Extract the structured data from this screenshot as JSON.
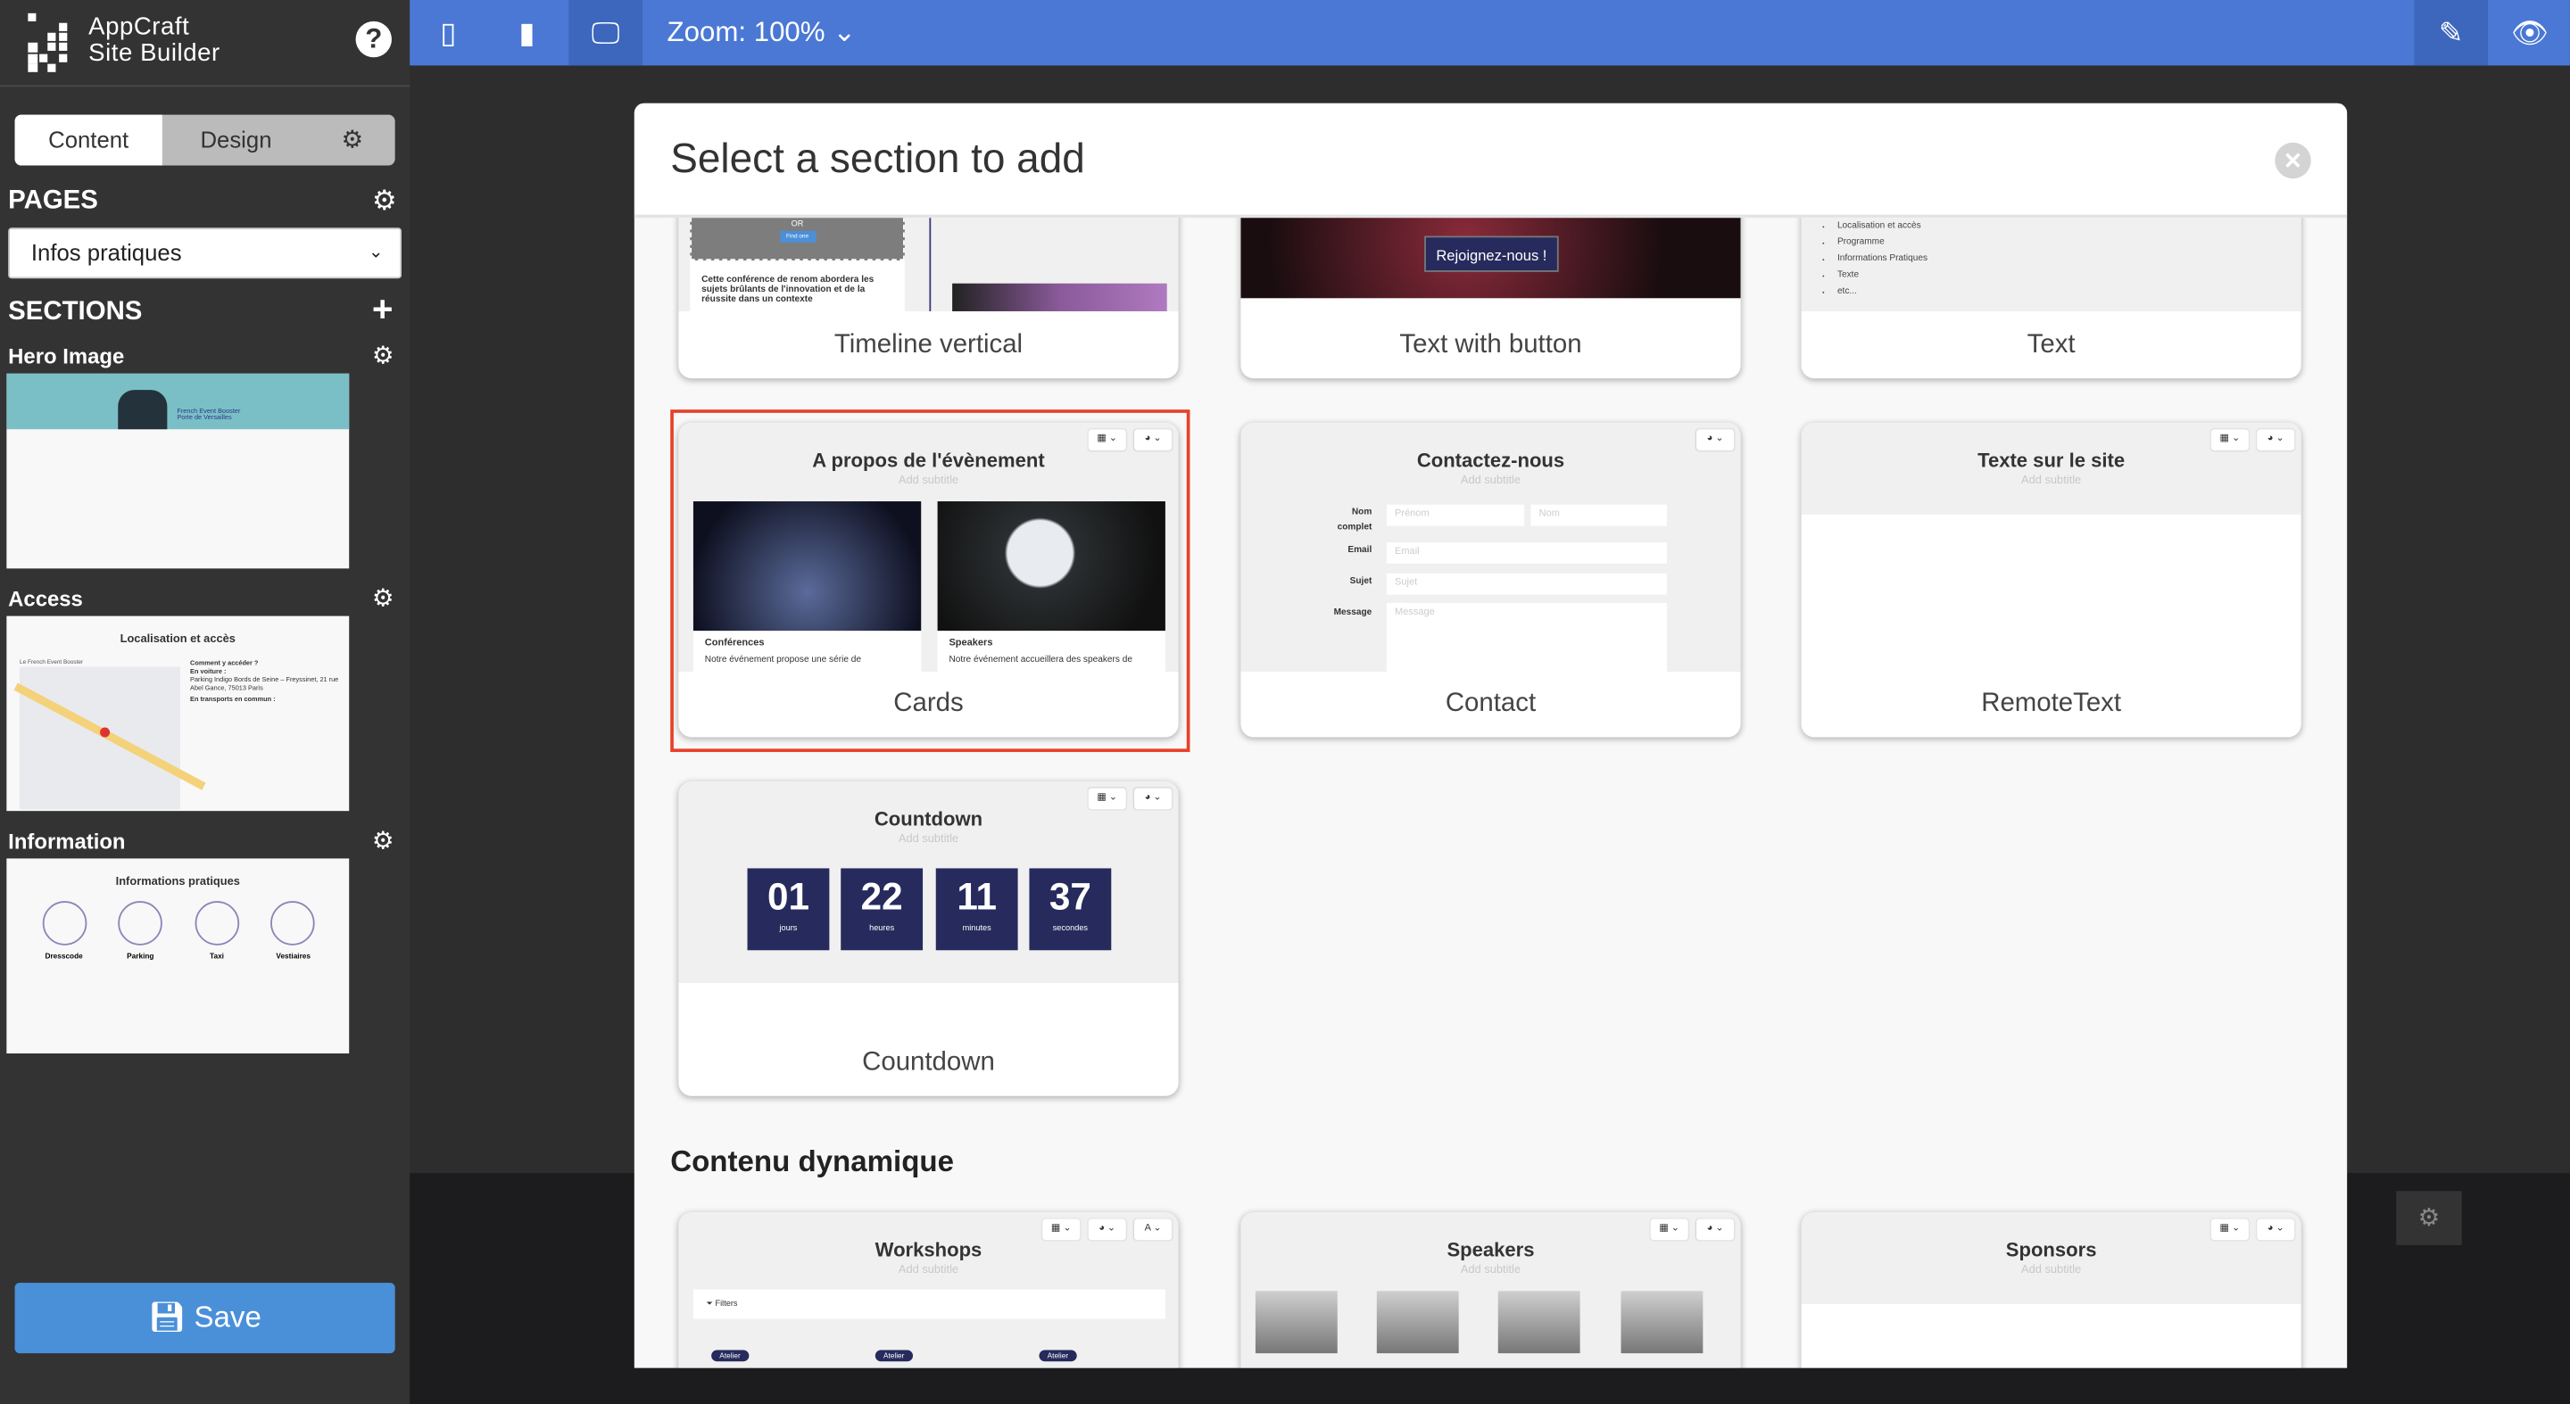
{
  "app": {
    "name_line1": "AppCraft",
    "name_line2": "Site Builder",
    "help_icon": "question-circle-icon"
  },
  "sidebar": {
    "tabs": {
      "content": "Content",
      "design": "Design"
    },
    "pages_heading": "PAGES",
    "page_select": "Infos pratiques",
    "sections_heading": "SECTIONS",
    "sections": [
      {
        "label": "Hero Image",
        "thumb": {
          "caption1": "French Event Booster",
          "caption2": "Porte de Versailles"
        }
      },
      {
        "label": "Access",
        "thumb": {
          "title": "Localisation et accès",
          "map_title": "Le French Event Booster",
          "how": "Comment y accéder ?",
          "car": "En voiture :",
          "addr": "Parking Indigo Bords de Seine – Freyssinet, 21 rue Abel Gance, 75013 Paris",
          "transit": "En transports en commun :"
        }
      },
      {
        "label": "Information",
        "thumb": {
          "title": "Informations pratiques",
          "items": [
            "Dresscode",
            "Parking",
            "Taxi",
            "Vestiaires"
          ]
        }
      }
    ],
    "save": "Save"
  },
  "topbar": {
    "zoom": "Zoom: 100%"
  },
  "modal": {
    "title": "Select a section to add",
    "row1": [
      {
        "label": "Timeline vertical",
        "or": "OR",
        "find": "Find one",
        "text": "Cette conférence de renom abordera les sujets brûlants de l'innovation et de la réussite dans un contexte"
      },
      {
        "label": "Text with button",
        "button": "Rejoignez-nous !"
      },
      {
        "label": "Text",
        "bullets": [
          "Localisation et accès",
          "Programme",
          "Informations Pratiques",
          "Texte",
          "etc..."
        ]
      }
    ],
    "cards": {
      "label": "Cards",
      "title": "A propos de l'évènement",
      "subtitle": "Add subtitle",
      "items": [
        {
          "title": "Conférences",
          "text": "Notre événement propose une série de"
        },
        {
          "title": "Speakers",
          "text": "Notre événement accueillera des speakers de"
        }
      ]
    },
    "contact": {
      "label": "Contact",
      "title": "Contactez-nous",
      "subtitle": "Add subtitle",
      "nom_label": "Nom complet",
      "prenom": "Prénom",
      "nom": "Nom",
      "email_label": "Email",
      "email": "Email",
      "sujet_label": "Sujet",
      "sujet": "Sujet",
      "message_label": "Message",
      "message": "Message"
    },
    "remote": {
      "label": "RemoteText",
      "title": "Texte sur le site",
      "subtitle": "Add subtitle"
    },
    "countdown": {
      "label": "Countdown",
      "title": "Countdown",
      "subtitle": "Add subtitle",
      "units": [
        {
          "v": "01",
          "u": "jours"
        },
        {
          "v": "22",
          "u": "heures"
        },
        {
          "v": "11",
          "u": "minutes"
        },
        {
          "v": "37",
          "u": "secondes"
        }
      ]
    },
    "dynamic_heading": "Contenu dynamique",
    "dynamic": [
      {
        "title": "Workshops",
        "subtitle": "Add subtitle",
        "filters": "Filters",
        "badge": "Atelier"
      },
      {
        "title": "Speakers",
        "subtitle": "Add subtitle"
      },
      {
        "title": "Sponsors",
        "subtitle": "Add subtitle"
      }
    ]
  }
}
